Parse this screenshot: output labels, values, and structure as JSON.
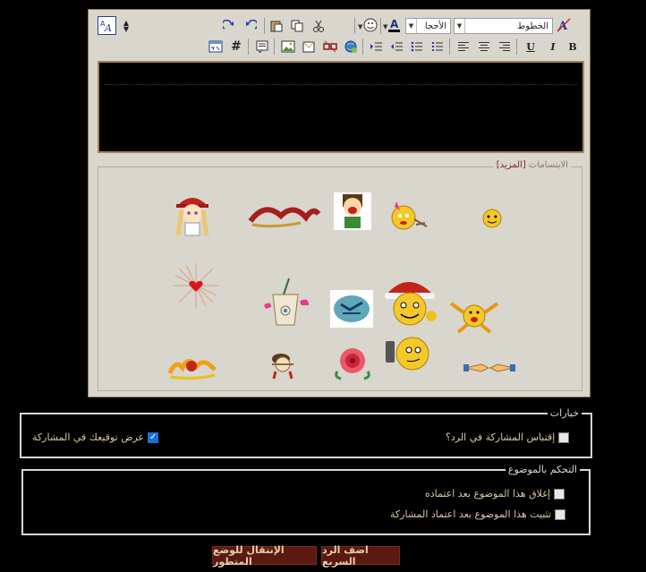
{
  "toolbar": {
    "font_select": "الخطوط",
    "size_select": "الأحجا",
    "buttons": [
      "bold",
      "italic",
      "underline",
      "align-left",
      "align-center",
      "align-right",
      "ordered-list",
      "unordered-list",
      "outdent",
      "indent",
      "insert-link",
      "insert-email",
      "remove-link",
      "insert-image",
      "insert-video",
      "wrap-quote",
      "wrap-code",
      "wrap-html",
      "cut",
      "copy",
      "paste",
      "undo",
      "redo",
      "smilie",
      "text-color",
      "remove-format",
      "switch-mode",
      "resize"
    ],
    "bold_label": "B",
    "italic_label": "I",
    "underline_label": "U",
    "code_label": "#"
  },
  "smilies": {
    "legend": "الابتسامات",
    "more": "[المزيد]"
  },
  "options": {
    "legend": "خيارات",
    "quote_label": "إقتباس المشاركة في الرد؟",
    "signature_label": "عرض توقيعك في المشاركة",
    "quote_checked": false,
    "signature_checked": true
  },
  "thread": {
    "legend": "التحكم بالموضوع",
    "close_label": "إغلاق هذا الموضوع بعد اعتماده",
    "sticky_label": "تثبيت هذا الموضوع بعد اعتماد المشاركة"
  },
  "actions": {
    "quick_reply": "اضف الرد السريع",
    "advanced": "الإنتقال للوضع المتطور"
  },
  "colors": {
    "panel": "#d9d6cd",
    "button_bg": "#5a1a12",
    "label_text": "#d9c9a3"
  }
}
